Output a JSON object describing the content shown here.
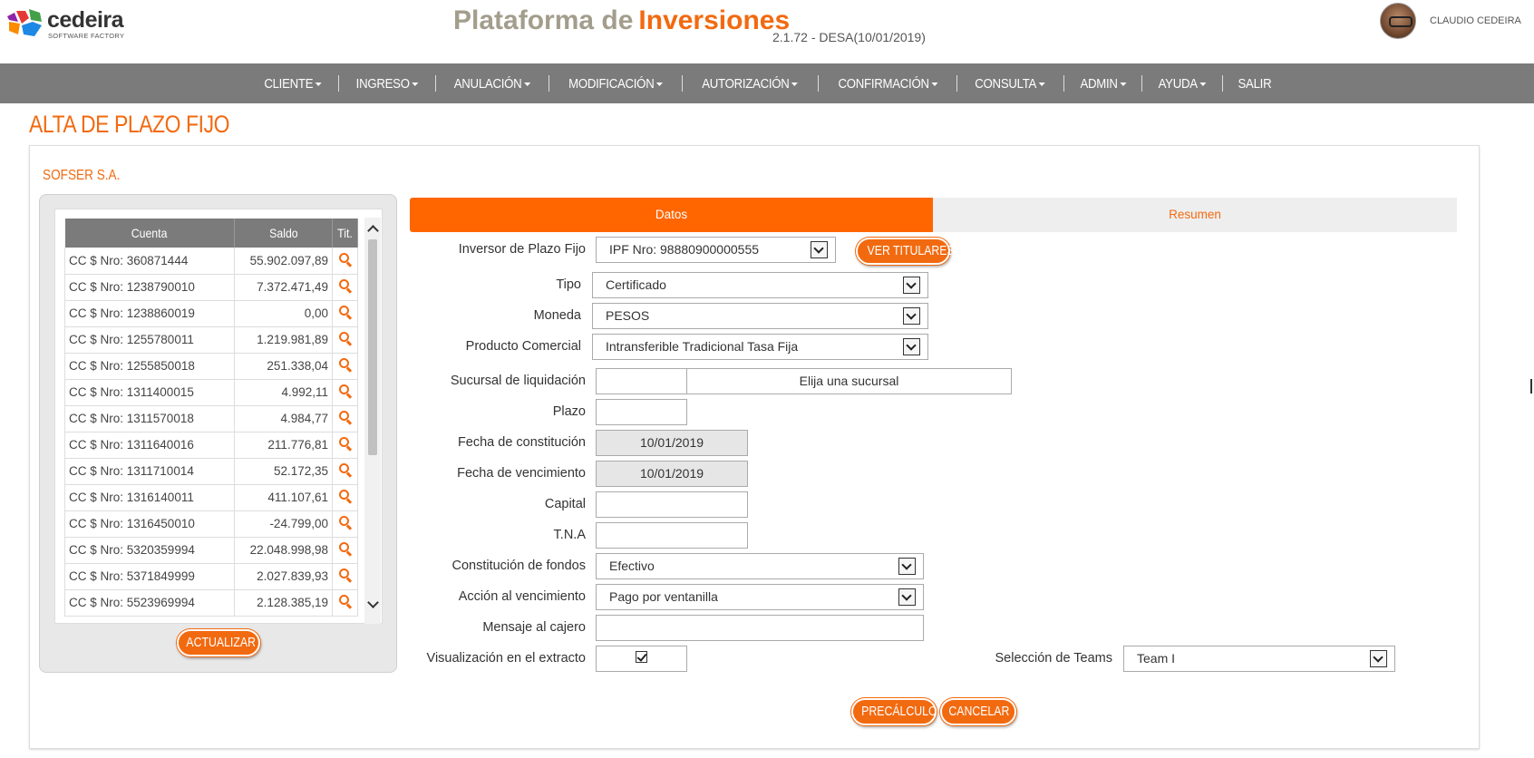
{
  "header": {
    "logo_name": "cedeira",
    "logo_sub": "SOFTWARE FACTORY",
    "title_part1": "Plataforma de",
    "title_part2": "Inversiones",
    "version": "2.1.72 - DESA(10/01/2019)",
    "user_name": "CLAUDIO CEDEIRA",
    "brand_color": "#f26a10"
  },
  "nav": {
    "items": [
      {
        "label": "CLIENTE",
        "dropdown": true
      },
      {
        "label": "INGRESO",
        "dropdown": true
      },
      {
        "label": "ANULACIÓN",
        "dropdown": true
      },
      {
        "label": "MODIFICACIÓN",
        "dropdown": true
      },
      {
        "label": "AUTORIZACIÓN",
        "dropdown": true
      },
      {
        "label": "CONFIRMACIÓN",
        "dropdown": true
      },
      {
        "label": "CONSULTA",
        "dropdown": true
      },
      {
        "label": "ADMIN",
        "dropdown": true
      },
      {
        "label": "AYUDA",
        "dropdown": true
      },
      {
        "label": "SALIR",
        "dropdown": false
      }
    ]
  },
  "page": {
    "title": "ALTA DE PLAZO FIJO",
    "company": "SOFSER S.A."
  },
  "accounts": {
    "headers": {
      "cuenta": "Cuenta",
      "saldo": "Saldo",
      "tit": "Tit."
    },
    "rows": [
      {
        "cuenta": "CC $ Nro: 360871444",
        "saldo": "55.902.097,89"
      },
      {
        "cuenta": "CC $ Nro: 1238790010",
        "saldo": "7.372.471,49"
      },
      {
        "cuenta": "CC $ Nro: 1238860019",
        "saldo": "0,00"
      },
      {
        "cuenta": "CC $ Nro: 1255780011",
        "saldo": "1.219.981,89"
      },
      {
        "cuenta": "CC $ Nro: 1255850018",
        "saldo": "251.338,04"
      },
      {
        "cuenta": "CC $ Nro: 1311400015",
        "saldo": "4.992,11"
      },
      {
        "cuenta": "CC $ Nro: 1311570018",
        "saldo": "4.984,77"
      },
      {
        "cuenta": "CC $ Nro: 1311640016",
        "saldo": "211.776,81"
      },
      {
        "cuenta": "CC $ Nro: 1311710014",
        "saldo": "52.172,35"
      },
      {
        "cuenta": "CC $ Nro: 1316140011",
        "saldo": "411.107,61"
      },
      {
        "cuenta": "CC $ Nro: 1316450010",
        "saldo": "-24.799,00"
      },
      {
        "cuenta": "CC $ Nro: 5320359994",
        "saldo": "22.048.998,98"
      },
      {
        "cuenta": "CC $ Nro: 5371849999",
        "saldo": "2.027.839,93"
      },
      {
        "cuenta": "CC $ Nro: 5523969994",
        "saldo": "2.128.385,19"
      }
    ],
    "actualizar_label": "ACTUALIZAR"
  },
  "tabs": {
    "datos": "Datos",
    "resumen": "Resumen"
  },
  "form": {
    "inversor_label": "Inversor de Plazo Fijo",
    "inversor_value": "IPF Nro: 98880900000555",
    "ver_titulares_label": "VER TITULARES",
    "tipo_label": "Tipo",
    "tipo_value": "Certificado",
    "moneda_label": "Moneda",
    "moneda_value": "PESOS",
    "producto_label": "Producto Comercial",
    "producto_value": "Intransferible Tradicional Tasa Fija",
    "sucursal_label": "Sucursal de liquidación",
    "sucursal_code_value": "",
    "sucursal_value": "Elija una sucursal",
    "plazo_label": "Plazo",
    "plazo_value": "",
    "fecha_constitucion_label": "Fecha de constitución",
    "fecha_constitucion_value": "10/01/2019",
    "fecha_vencimiento_label": "Fecha de vencimiento",
    "fecha_vencimiento_value": "10/01/2019",
    "capital_label": "Capital",
    "capital_value": "",
    "tna_label": "T.N.A",
    "tna_value": "",
    "constitucion_fondos_label": "Constitución de fondos",
    "constitucion_fondos_value": "Efectivo",
    "accion_vencimiento_label": "Acción al vencimiento",
    "accion_vencimiento_value": "Pago por ventanilla",
    "mensaje_cajero_label": "Mensaje al cajero",
    "mensaje_cajero_value": "",
    "visualizacion_label": "Visualización en el extracto",
    "visualizacion_checked": true,
    "teams_label": "Selección de Teams",
    "teams_value": "Team I",
    "precalculo_label": "PRECÁLCULO",
    "cancelar_label": "CANCELAR"
  }
}
